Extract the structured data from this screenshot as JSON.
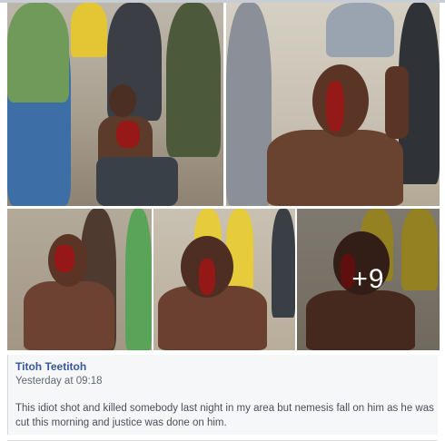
{
  "post": {
    "author": "Titoh Teetitoh",
    "timestamp": "Yesterday at 09:18",
    "message": "This idiot shot and killed somebody last night in my area but nemesis fall on him as he was cut this morning and justice was done on him."
  },
  "gallery": {
    "more_count_label": "+9"
  },
  "colors": {
    "author_link": "#365899",
    "meta_text": "#616770",
    "body_text": "#4b4f56",
    "post_background": "#f6f7f9"
  }
}
